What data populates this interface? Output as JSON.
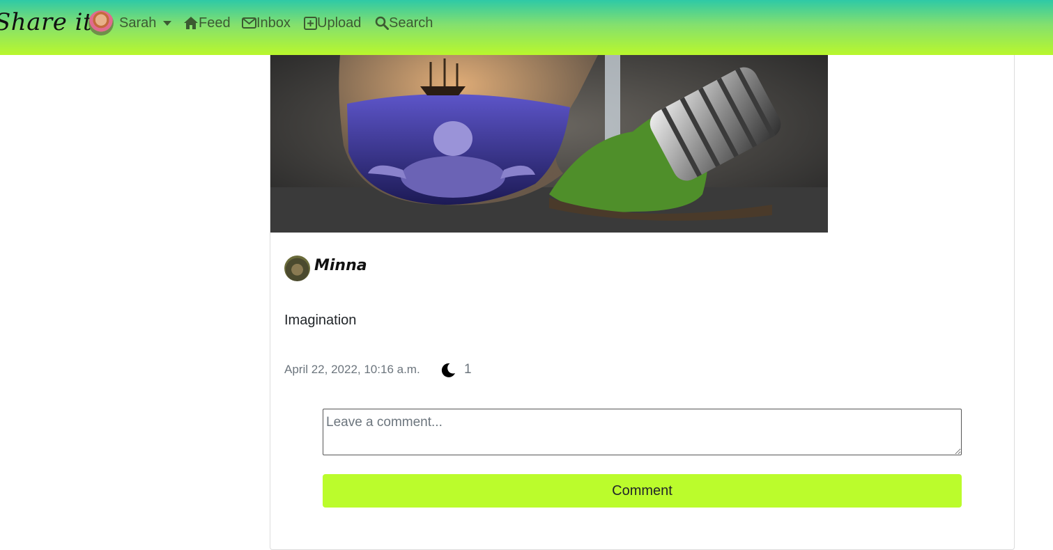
{
  "navbar": {
    "brand": "Share it",
    "user_name": "Sarah",
    "links": {
      "feed": "Feed",
      "inbox": "Inbox",
      "upload": "Upload",
      "search": "Search"
    },
    "icons": [
      "home-icon",
      "envelope-icon",
      "plus-square-icon",
      "search-icon"
    ]
  },
  "post": {
    "image_description_icon": "post-photo",
    "author": "Minna",
    "caption": "Imagination",
    "timestamp": "April 22, 2022, 10:16 a.m.",
    "like_icon": "moon-icon",
    "like_count": "1"
  },
  "comment_form": {
    "placeholder": "Leave a comment...",
    "value": "",
    "submit_label": "Comment"
  },
  "colors": {
    "navbar_top": "#2ec9a6",
    "navbar_bottom": "#b9f72c",
    "nav_text": "#3c5a32",
    "button_bg": "#bbfc2c",
    "muted_text": "#6c757d"
  }
}
